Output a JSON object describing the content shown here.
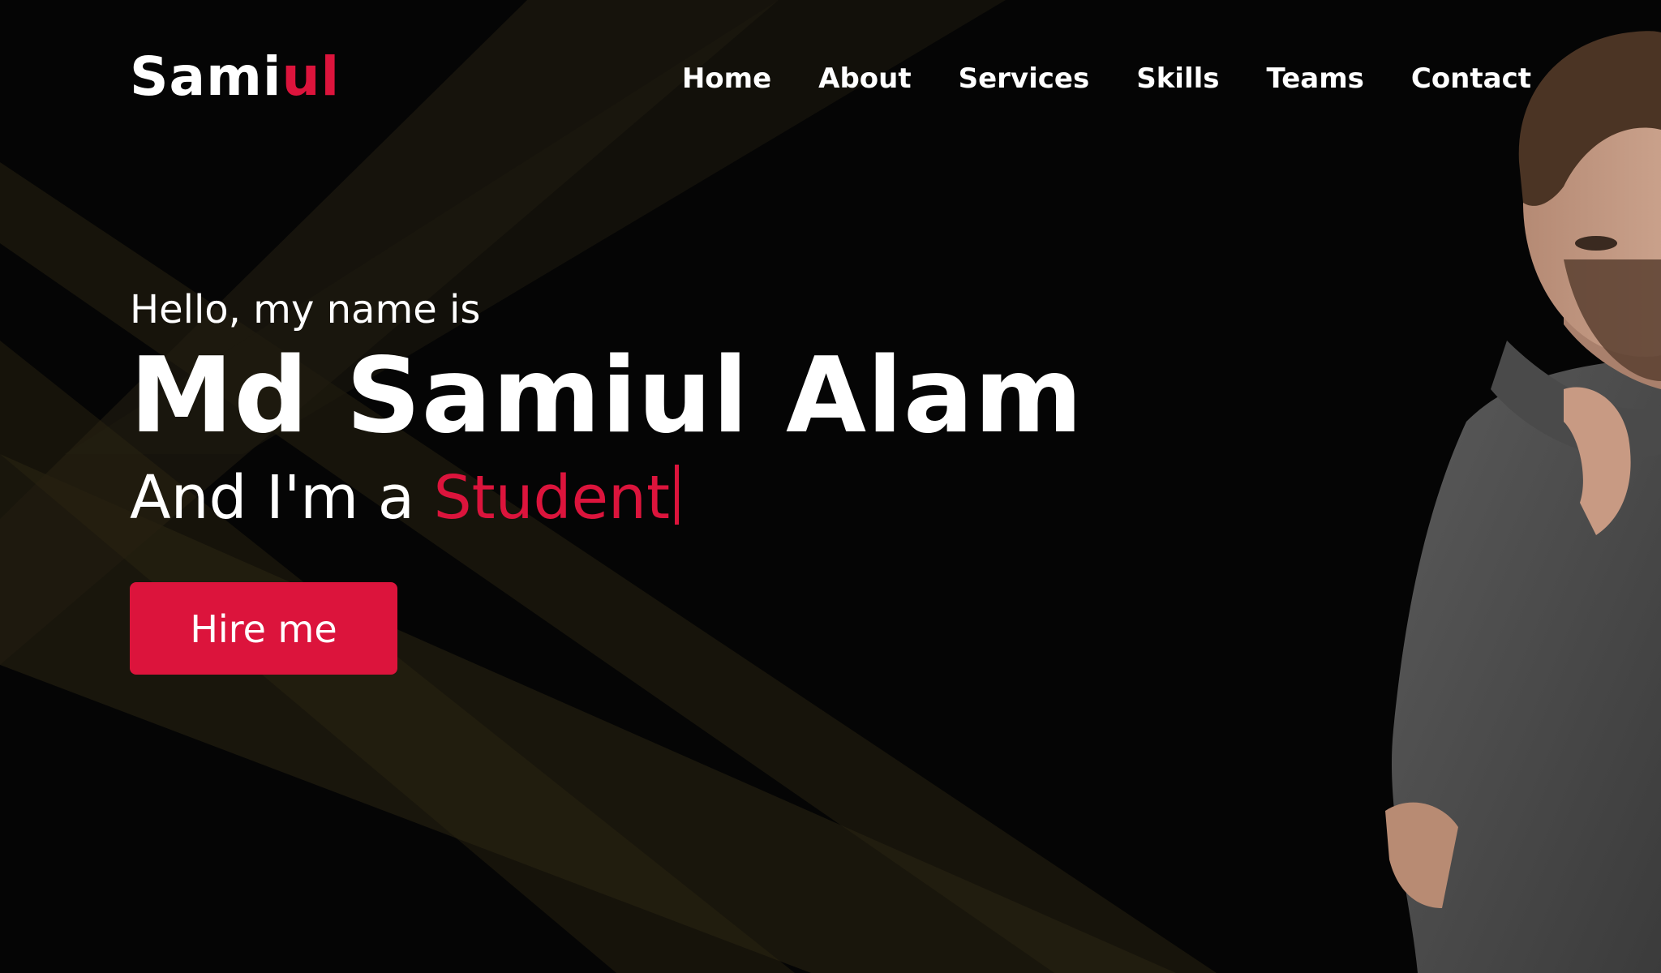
{
  "brand": {
    "name_main": "Sami",
    "name_accent": "ul",
    "accent_color": "#dc143c"
  },
  "nav": {
    "items": [
      {
        "label": "Home"
      },
      {
        "label": "About"
      },
      {
        "label": "Services"
      },
      {
        "label": "Skills"
      },
      {
        "label": "Teams"
      },
      {
        "label": "Contact"
      }
    ]
  },
  "hero": {
    "greeting": "Hello, my name is",
    "name": "Md Samiul Alam",
    "role_prefix": "And I'm a",
    "role_word": "Student",
    "cta_label": "Hire me"
  },
  "colors": {
    "background": "#050505",
    "text": "#ffffff",
    "accent": "#dc143c",
    "rays": "#3a2f14"
  }
}
